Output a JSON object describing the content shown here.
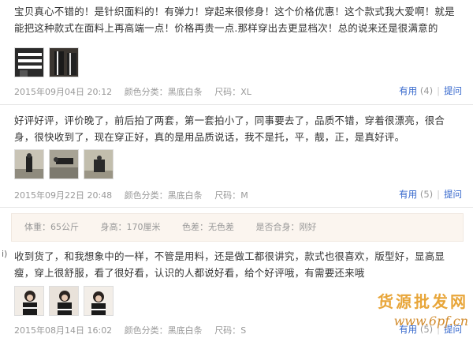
{
  "reviews": [
    {
      "text": "宝贝真心不错的！是针织面料的！有弹力！穿起来很修身！这个价格优惠！这个款式我大爱啊！就是能把这种款式在面料上再高端一点！价格再贵一点.那样穿出去更显档次！总的说来还是很满意的",
      "date": "2015年09月04日 20:12",
      "color_label": "颜色分类：",
      "color_value": "黑底白条",
      "size_label": "尺码：",
      "size_value": "XL",
      "useful_label": "有用",
      "useful_count": "(4)",
      "ask_label": "提问"
    },
    {
      "text": "好评好评，评价晚了，前后拍了两套，第一套拍小了，同事要去了，品质不错，穿着很漂亮，很合身，很快收到了，现在穿正好，真的是用品质说话，我不是托，平，靓，正，是真好评。",
      "date": "2015年09月22日 20:48",
      "color_label": "颜色分类：",
      "color_value": "黑底白条",
      "size_label": "尺码：",
      "size_value": "M",
      "useful_label": "有用",
      "useful_count": "(5)",
      "ask_label": "提问"
    },
    {
      "text": "收到货了，和我想象中的一样，不管是用料，还是做工都很讲究，款式也很喜欢，版型好，显高显瘦，穿上很舒服，看了很好看，认识的人都说好看，给个好评哦，有需要还来哦",
      "date": "2015年08月14日 16:02",
      "color_label": "颜色分类：",
      "color_value": "黑底白条",
      "size_label": "尺码：",
      "size_value": "S",
      "useful_label": "有用",
      "useful_count": "(5)",
      "ask_label": "提问"
    }
  ],
  "attributes": {
    "weight": "体重：65公斤",
    "height": "身高：170厘米",
    "color_diff": "色差：无色差",
    "fit": "是否合身：刚好"
  },
  "stray_mark": "i)",
  "watermark": {
    "title": "货源批发网",
    "url": "www.6pf.cn"
  },
  "colors": {
    "link": "#3366cc",
    "muted": "#999999",
    "attr_bg": "#fbf5ef",
    "watermark": "#e8a63a"
  }
}
